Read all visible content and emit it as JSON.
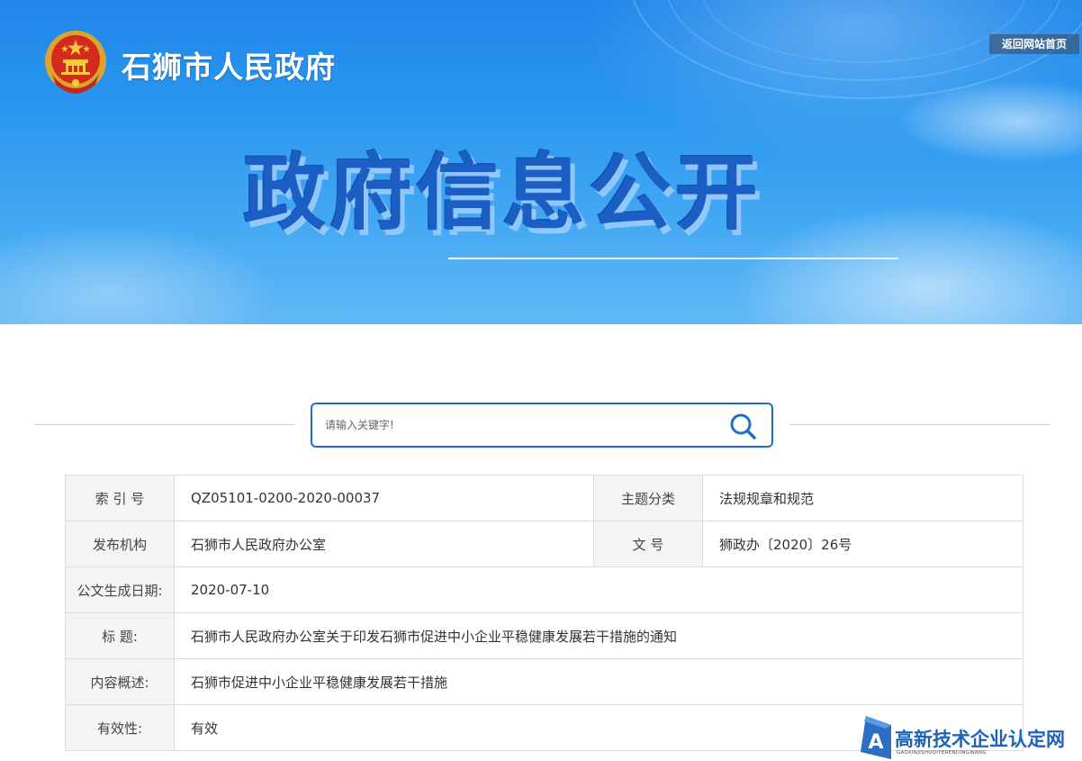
{
  "header": {
    "site_name": "石狮市人民政府",
    "home_button": "返回网站首页",
    "emblem_icon": "national-emblem-icon"
  },
  "hero": {
    "title": "政府信息公开"
  },
  "search": {
    "placeholder": "请输入关键字!",
    "icon": "search-icon",
    "accent_color": "#1f6fc4"
  },
  "info": {
    "index_label": "索 引 号",
    "index_value": "QZ05101-0200-2020-00037",
    "topic_label": "主题分类",
    "topic_value": "法规规章和规范",
    "publisher_label": "发布机构",
    "publisher_value": "石狮市人民政府办公室",
    "doc_no_label": "文  号",
    "doc_no_value": "狮政办〔2020〕26号",
    "date_label": "公文生成日期:",
    "date_value": "2020-07-10",
    "title_label": "标  题:",
    "title_value": "石狮市人民政府办公室关于印发石狮市促进中小企业平稳健康发展若干措施的通知",
    "summary_label": "内容概述:",
    "summary_value": "石狮市促进中小企业平稳健康发展若干措施",
    "validity_label": "有效性:",
    "validity_value": "有效"
  },
  "watermark": {
    "title": "高新技术企业认定网",
    "subtitle": "GAOXINJISHUQIYERENDINGWANG"
  },
  "colors": {
    "banner_top": "#1f86ea",
    "banner_bottom": "#63b8f5",
    "hero_text": "#1b5fc4",
    "label_bg": "#f4f4f4",
    "border": "#dcdcdc"
  }
}
